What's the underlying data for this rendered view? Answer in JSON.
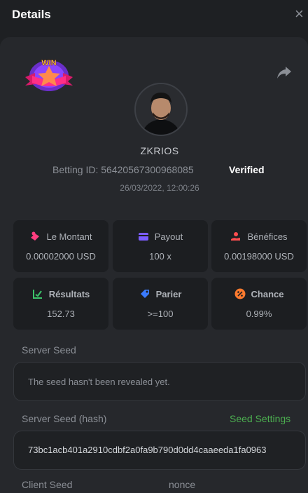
{
  "header": {
    "title": "Details",
    "close_symbol": "×"
  },
  "badge": {
    "text": "WIN"
  },
  "player": {
    "name": "ZKRIOS",
    "betting_id": "Betting ID: 56420567300968085",
    "verified_label": "Verified",
    "timestamp": "26/03/2022, 12:00:26"
  },
  "stats": [
    {
      "label": "Le Montant",
      "value": "0.00002000 USD",
      "icon": "coins-icon",
      "color": "#ff3d7f"
    },
    {
      "label": "Payout",
      "value": "100 x",
      "icon": "wallet-icon",
      "color": "#7b5cff"
    },
    {
      "label": "Bénéfices",
      "value": "0.00198000 USD",
      "icon": "profit-hand-icon",
      "color": "#ff4d4f"
    },
    {
      "label": "Résultats",
      "value": "152.73",
      "icon": "chart-check-icon",
      "color": "#3cc36a"
    },
    {
      "label": "Parier",
      "value": ">=100",
      "icon": "tag-icon",
      "color": "#3a7bff"
    },
    {
      "label": "Chance",
      "value": "0.99%",
      "icon": "percent-icon",
      "color": "#ff7a2e"
    }
  ],
  "server_seed": {
    "label": "Server Seed",
    "value": "The seed hasn't been revealed yet."
  },
  "server_seed_hash": {
    "label": "Server Seed (hash)",
    "settings_link": "Seed Settings",
    "value": "73bc1acb401a2910cdbf2a0fa9b790d0dd4caaeeda1fa0963"
  },
  "client_seed": {
    "label": "Client Seed",
    "nonce_label": "nonce"
  }
}
